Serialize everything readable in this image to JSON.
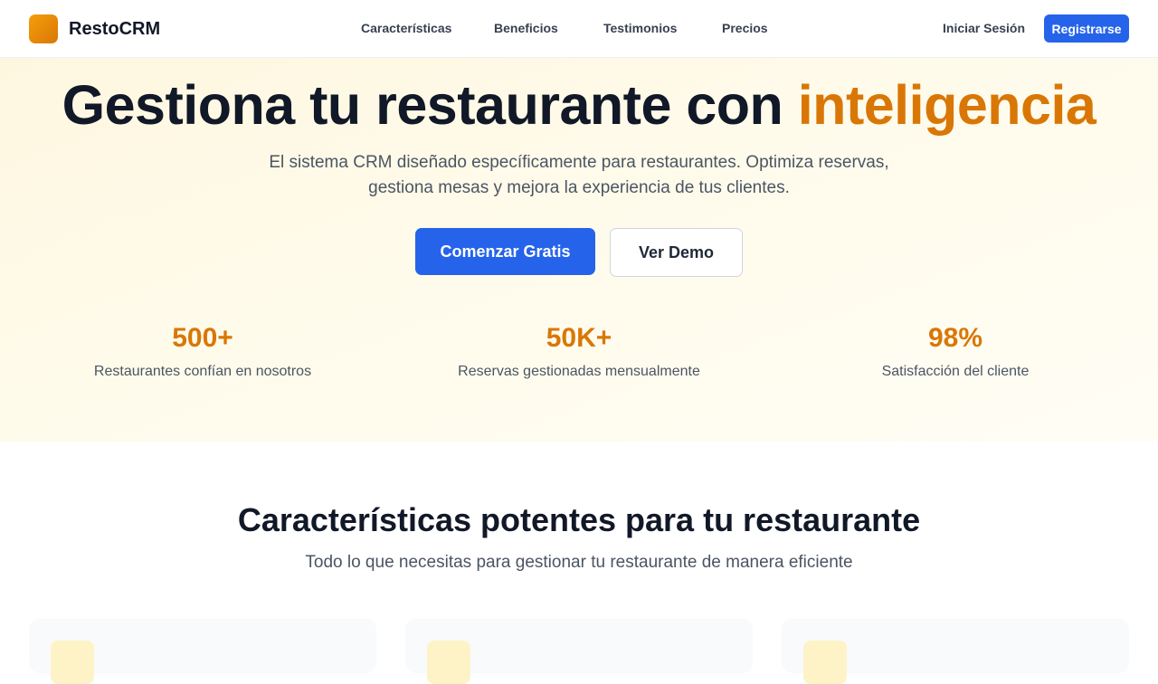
{
  "brand": {
    "name": "RestoCRM"
  },
  "nav": {
    "links": [
      "Características",
      "Beneficios",
      "Testimonios",
      "Precios"
    ],
    "login": "Iniciar Sesión",
    "signup": "Registrarse"
  },
  "hero": {
    "title_main": "Gestiona tu restaurante con ",
    "title_accent": "inteligencia",
    "subtitle": "El sistema CRM diseñado específicamente para restaurantes. Optimiza reservas, gestiona mesas y mejora la experiencia de tus clientes.",
    "cta_primary": "Comenzar Gratis",
    "cta_secondary": "Ver Demo"
  },
  "stats": [
    {
      "value": "500+",
      "label": "Restaurantes confían en nosotros"
    },
    {
      "value": "50K+",
      "label": "Reservas gestionadas mensualmente"
    },
    {
      "value": "98%",
      "label": "Satisfacción del cliente"
    }
  ],
  "features": {
    "title": "Características potentes para tu restaurante",
    "subtitle": "Todo lo que necesitas para gestionar tu restaurante de manera eficiente"
  },
  "colors": {
    "primary": "#2563eb",
    "accent": "#d97706",
    "hero_bg": "#fffbeb",
    "card_bg": "#f9fafb",
    "icon_bg": "#fef3c7"
  }
}
